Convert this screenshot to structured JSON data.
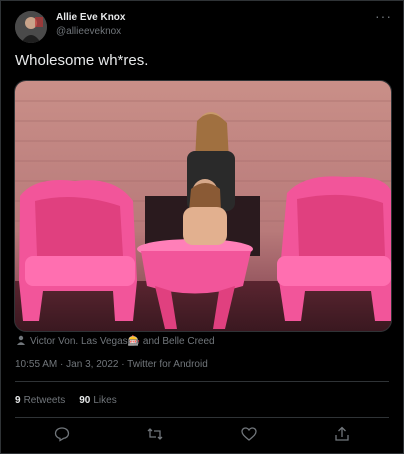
{
  "author": {
    "display_name": "Allie Eve Knox",
    "handle": "@allieeveknox"
  },
  "tweet": {
    "text": "Wholesome wh*res."
  },
  "tagged": {
    "text": "Victor Von. Las Vegas🎰 and Belle Creed"
  },
  "meta": {
    "time": "10:55 AM",
    "date": "Jan 3, 2022",
    "source": "Twitter for Android",
    "separator": "·"
  },
  "stats": {
    "retweets_count": "9",
    "retweets_label": "Retweets",
    "likes_count": "90",
    "likes_label": "Likes"
  },
  "colors": {
    "background": "#000000",
    "text_primary": "#e7e9ea",
    "text_secondary": "#71767b",
    "border": "#2f3336"
  },
  "icons": {
    "more": "more-icon",
    "reply": "reply-icon",
    "retweet": "retweet-icon",
    "like": "heart-icon",
    "share": "share-icon",
    "tag": "person-icon"
  }
}
